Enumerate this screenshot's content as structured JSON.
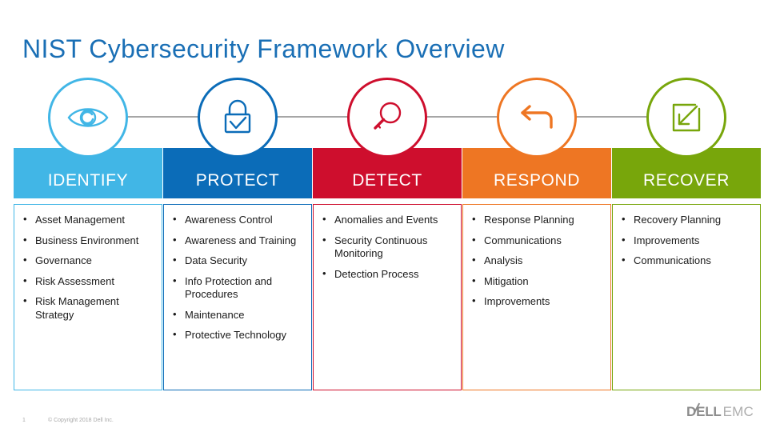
{
  "slide": {
    "title": "NIST Cybersecurity Framework Overview",
    "title_color": "#1A6FB5",
    "background": "#FFFFFF"
  },
  "footer": {
    "page_number": "1",
    "copyright": "© Copyright 2018 Dell Inc.",
    "brand_primary": "DELL",
    "brand_secondary": "EMC"
  },
  "functions": [
    {
      "id": "identify",
      "label": "IDENTIFY",
      "color": "#41B6E6",
      "icon": "eye-icon",
      "items": [
        "Asset Management",
        "Business Environment",
        "Governance",
        "Risk Assessment",
        "Risk Management Strategy"
      ]
    },
    {
      "id": "protect",
      "label": "PROTECT",
      "color": "#0B6CB8",
      "icon": "padlock-check-icon",
      "items": [
        "Awareness Control",
        "Awareness and Training",
        "Data Security",
        "Info Protection and Procedures",
        "Maintenance",
        "Protective Technology"
      ]
    },
    {
      "id": "detect",
      "label": "DETECT",
      "color": "#CE0E2D",
      "icon": "magnifier-icon",
      "items": [
        "Anomalies and Events",
        "Security Continuous Monitoring",
        "Detection Process"
      ]
    },
    {
      "id": "respond",
      "label": "RESPOND",
      "color": "#EE7623",
      "icon": "reply-arrow-icon",
      "items": [
        "Response Planning",
        "Communications",
        "Analysis",
        "Mitigation",
        "Improvements"
      ]
    },
    {
      "id": "recover",
      "label": "RECOVER",
      "color": "#78A60B",
      "icon": "arrow-into-box-icon",
      "items": [
        "Recovery Planning",
        "Improvements",
        "Communications"
      ]
    }
  ]
}
